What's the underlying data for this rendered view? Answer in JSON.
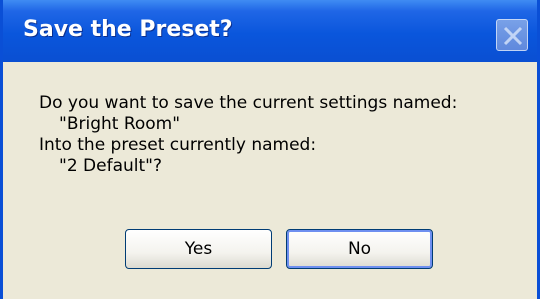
{
  "window": {
    "title": "Save the Preset?",
    "close_icon": "close-icon"
  },
  "message": {
    "line1": "Do you want to save the current settings named:",
    "line2": "\"Bright Room\"",
    "line3": "Into the preset currently named:",
    "line4": "\"2 Default\"?"
  },
  "buttons": {
    "yes_label": "Yes",
    "no_label": "No"
  },
  "colors": {
    "titlebar": "#0a56dc",
    "dialog_background": "#ece9d8",
    "button_border": "#003c74"
  }
}
